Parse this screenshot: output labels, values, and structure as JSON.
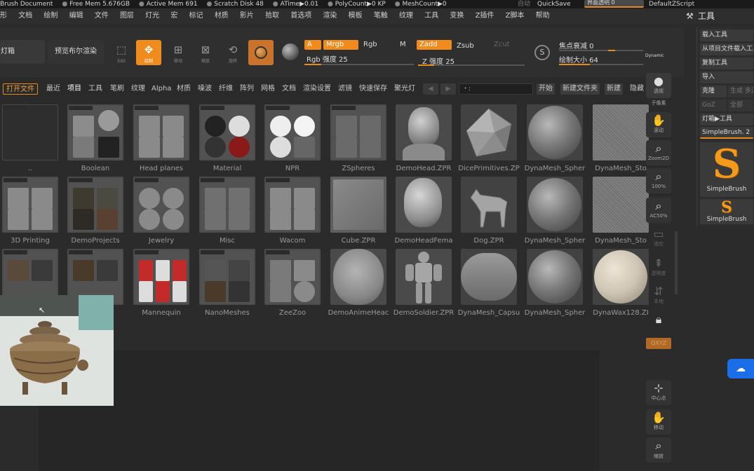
{
  "status_bar": {
    "items": [
      "Brush Document",
      "Free Mem 5.676GB",
      "Active Mem 691",
      "Scratch Disk 48",
      "ATime▶0.01",
      "PolyCount▶0 KP",
      "MeshCount▶0"
    ],
    "auto_label": "自动",
    "quicksave_label": "QuickSave",
    "transparency_label": "界面透明 0",
    "default_script_label": "DefaultZScript"
  },
  "menu": [
    "形",
    "文档",
    "绘制",
    "编辑",
    "文件",
    "图层",
    "灯光",
    "宏",
    "标记",
    "材质",
    "影片",
    "拾取",
    "首选项",
    "渲染",
    "模板",
    "笔触",
    "纹理",
    "工具",
    "变换",
    "Z插件",
    "Z脚本",
    "帮助"
  ],
  "tool_panel_title": "工具",
  "shelf": {
    "lightbox_label": "灯箱",
    "preview_render_label": "预览布尔渲染",
    "edit_label": "Edit",
    "draw_label": "绘制",
    "move_label": "移动",
    "scale_label": "缩放",
    "rotate_label": "旋转",
    "mrgb": {
      "a": "A",
      "mrgb": "Mrgb",
      "rgb": "Rgb",
      "m": "M"
    },
    "z": {
      "zadd": "Zadd",
      "zsub": "Zsub",
      "zcut": "Zcut"
    },
    "rgb_intensity_label": "Rgb 强度 25",
    "rgb_intensity_value": 25,
    "z_intensity_label": "Z 强度 25",
    "z_intensity_value": 25,
    "focal_shift_label": "焦点衰减 0",
    "draw_size_label": "绘制大小 64",
    "dynamic_label": "Dynamic"
  },
  "lightbox_tabs": [
    "打开文件",
    "最近",
    "项目",
    "工具",
    "笔刷",
    "纹理",
    "Alpha",
    "材质",
    "噪波",
    "纤维",
    "阵列",
    "网格",
    "文档",
    "渲染设置",
    "滤镜",
    "快速保存",
    "聚光灯"
  ],
  "lightbox_active_tab": "项目",
  "lightbox_search_value": "・:",
  "lightbox_actions": {
    "start": "开始",
    "new_folder": "新建文件夹",
    "new": "新建",
    "hide": "隐藏"
  },
  "grid": {
    "row1": [
      "..",
      "Boolean",
      "Head planes",
      "Material",
      "NPR",
      "ZSpheres",
      "DemoHead.ZPR",
      "DicePrimitives.ZP",
      "DynaMesh_Spher",
      "DynaMesh_Sto"
    ],
    "row2": [
      "3D Printing",
      "DemoProjects",
      "Jewelry",
      "Misc",
      "Wacom",
      "Cube.ZPR",
      "DemoHeadFema",
      "Dog.ZPR",
      "DynaMesh_Spher",
      "DynaMesh_Sto"
    ],
    "row3": [
      "",
      "",
      "Mannequin",
      "NanoMeshes",
      "ZeeZoo",
      "DemoAnimeHeac",
      "DemoSoldier.ZPR",
      "DynaMesh_Capsu",
      "DynaMesh_Spher",
      "DynaWax128.ZI"
    ]
  },
  "dock": {
    "persp_label": "透视",
    "subpixel_label": "子像素",
    "scroll_label": "滚动",
    "zoom2d_label": "Zoom2D",
    "zoom100_label": "100%",
    "ac50_label": "AC50%",
    "frame_label": "适应",
    "transp_label": "透明度",
    "local_label": "本地",
    "lock_label": "锁定",
    "xyz_label": "QXYZ",
    "center_label": "中心点",
    "move_label": "移动",
    "rotate_label": "缩放"
  },
  "tool_panel": {
    "load_tool": "载入工具",
    "load_from_project": "从项目文件载入工具",
    "copy_tool": "复制工具",
    "import": "导入",
    "clone": "克隆",
    "make_polymesh": "生成 多边",
    "goz": "GoZ",
    "all": "全部",
    "lightbox_tool": "灯箱▶工具",
    "current_brush": "SimpleBrush. 2",
    "brush1_name": "SimpleBrush",
    "brush2_name": "SimpleBrush"
  },
  "colors": {
    "accent": "#f08c1e",
    "panel": "#2b2b2b",
    "cloud": "#1a6ee8"
  }
}
